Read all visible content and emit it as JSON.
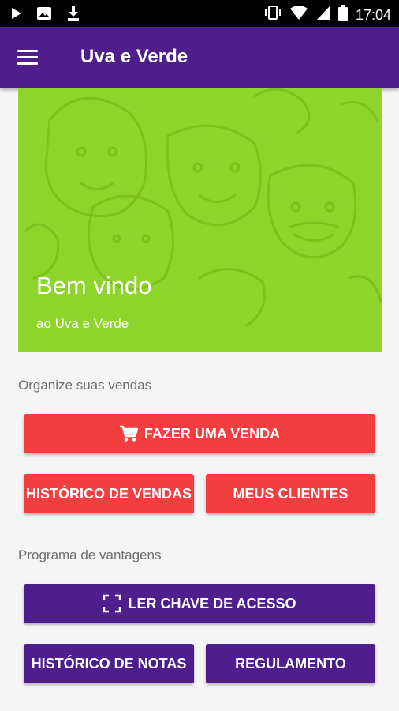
{
  "status_bar": {
    "icons": [
      "play-icon",
      "image-icon",
      "download-icon",
      "vibrate-icon",
      "wifi-icon",
      "signal-icon",
      "battery-icon"
    ],
    "time": "17:04"
  },
  "app_bar": {
    "menu_icon": "hamburger-menu-icon",
    "title": "Uva e Verde"
  },
  "hero": {
    "title": "Bem vindo",
    "subtitle": "ao Uva e Verde",
    "background_color": "#8dd42b"
  },
  "sales": {
    "label": "Organize suas vendas",
    "make_sale": {
      "icon": "cart-icon",
      "label": "FAZER UMA VENDA"
    },
    "history": {
      "label": "HISTÓRICO DE VENDAS"
    },
    "clients": {
      "label": "MEUS CLIENTES"
    }
  },
  "rewards": {
    "label": "Programa de vantagens",
    "scan": {
      "icon": "scan-frame-icon",
      "label": "LER CHAVE DE ACESSO"
    },
    "notes_history": {
      "label": "HISTÓRICO DE NOTAS"
    },
    "rules": {
      "label": "REGULAMENTO"
    }
  },
  "colors": {
    "primary": "#4e1f8c",
    "accent_red": "#f23e3e",
    "hero_green": "#8dd42b"
  }
}
